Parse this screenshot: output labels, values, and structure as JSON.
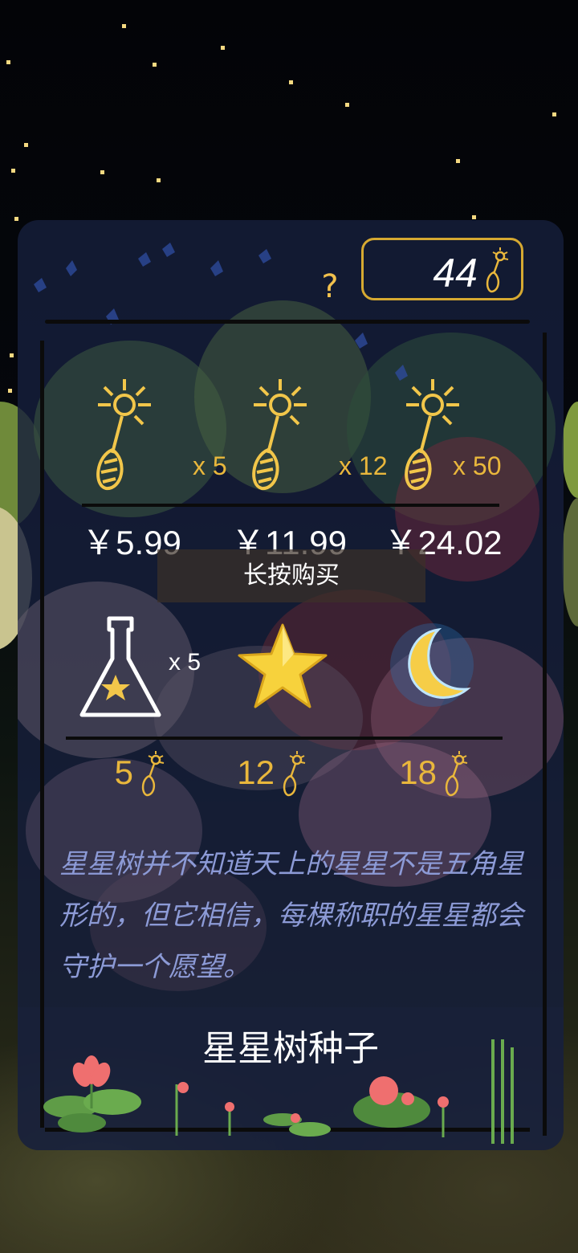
{
  "header": {
    "help_label": "?",
    "currency_amount": "44",
    "currency_icon": "star-seed-icon"
  },
  "seed_packs": [
    {
      "quantity_label": "x 5",
      "price": "￥5.99"
    },
    {
      "quantity_label": "x 12",
      "price": "￥11.99"
    },
    {
      "quantity_label": "x 50",
      "price": "￥24.02"
    }
  ],
  "purchase_hint": "长按购买",
  "items": [
    {
      "icon": "star-bottle-icon",
      "quantity_label": "x 5",
      "cost": "5"
    },
    {
      "icon": "star-icon",
      "quantity_label": "",
      "cost": "12"
    },
    {
      "icon": "moon-icon",
      "quantity_label": "",
      "cost": "18"
    }
  ],
  "description": "星星树并不知道天上的星星不是五角星形的，但它相信，每棵称职的星星都会守护一个愿望。",
  "product_title": "星星树种子",
  "colors": {
    "accent": "#e9b73c",
    "panel": "#161e3c",
    "description": "#8c9ad6"
  }
}
